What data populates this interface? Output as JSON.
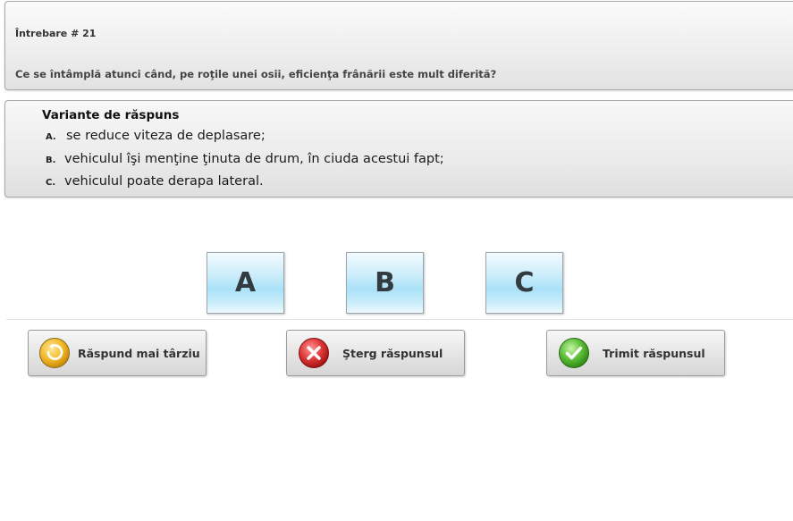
{
  "question": {
    "number_label": "Întrebare  # 21",
    "text": "Ce se întâmplă atunci când, pe roţile unei osii, eficienţa frânării este mult diferită?"
  },
  "answers": {
    "heading": "Variante de răspuns",
    "items": [
      {
        "letter": "A.",
        "text": "se reduce viteza de deplasare;"
      },
      {
        "letter": "B.",
        "text": "vehiculul îşi menţine ţinuta de drum, în ciuda acestui fapt;"
      },
      {
        "letter": "C.",
        "text": "vehiculul poate derapa lateral."
      }
    ]
  },
  "choices": [
    {
      "label": "A"
    },
    {
      "label": "B"
    },
    {
      "label": "C"
    }
  ],
  "actions": {
    "later": {
      "label": "Răspund mai târziu",
      "icon": "clock-refresh-icon",
      "color": "#f0b62a"
    },
    "delete": {
      "label": "Şterg răspunsul",
      "icon": "close-icon",
      "color": "#e23b3b"
    },
    "send": {
      "label": "Trimit răspunsul",
      "icon": "check-icon",
      "color": "#5fc13a"
    }
  },
  "colors": {
    "choice_button_blue": "#a9e1f7",
    "panel_gray": "#ebebeb"
  }
}
